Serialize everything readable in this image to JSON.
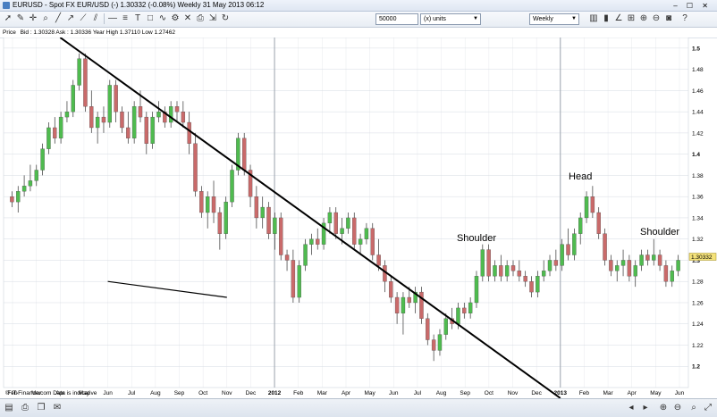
{
  "window": {
    "title": "EURUSD - Spot FX EUR/USD (-)   1.30332 (-0.08%)   Weekly  31 May 2013 06:12",
    "controls": "– ☐ ✕"
  },
  "toolbar": {
    "quantity_value": "50000",
    "units_value": "(x) units",
    "period_value": "Weekly"
  },
  "infobar": {
    "price_label": "Price",
    "quote_text": "Bid : 1.30328 Ask : 1.30336 Year High 1.37110 Low 1.27462"
  },
  "chart_data": {
    "type": "candlestick",
    "instrument": "EUR/USD",
    "timeframe": "Weekly",
    "y_range": [
      1.18,
      1.51
    ],
    "y_ticks": [
      "1.5",
      "1.48",
      "1.46",
      "1.44",
      "1.42",
      "1.4",
      "1.38",
      "1.36",
      "1.34",
      "1.32",
      "1.3",
      "1.28",
      "1.26",
      "1.24",
      "1.22",
      "1.2"
    ],
    "bold_ticks": [
      "1.5",
      "1.4",
      "1.3",
      "1.2"
    ],
    "x_labels": [
      "Feb",
      "Mar",
      "Apr",
      "May",
      "Jun",
      "Jul",
      "Aug",
      "Sep",
      "Oct",
      "Nov",
      "Dec",
      "2012",
      "Feb",
      "Mar",
      "Apr",
      "May",
      "Jun",
      "Jul",
      "Aug",
      "Sep",
      "Oct",
      "Nov",
      "Dec",
      "2013",
      "Feb",
      "Mar",
      "Apr",
      "May",
      "Jun"
    ],
    "year_separators": [
      "2012",
      "2013"
    ],
    "candles": [
      [
        1.36,
        1.365,
        1.35,
        1.355
      ],
      [
        1.355,
        1.37,
        1.345,
        1.365
      ],
      [
        1.365,
        1.38,
        1.36,
        1.37
      ],
      [
        1.37,
        1.39,
        1.365,
        1.375
      ],
      [
        1.375,
        1.39,
        1.37,
        1.385
      ],
      [
        1.385,
        1.41,
        1.38,
        1.405
      ],
      [
        1.405,
        1.43,
        1.4,
        1.425
      ],
      [
        1.425,
        1.435,
        1.41,
        1.415
      ],
      [
        1.415,
        1.44,
        1.41,
        1.435
      ],
      [
        1.435,
        1.45,
        1.43,
        1.44
      ],
      [
        1.44,
        1.47,
        1.435,
        1.465
      ],
      [
        1.465,
        1.495,
        1.46,
        1.49
      ],
      [
        1.49,
        1.495,
        1.44,
        1.445
      ],
      [
        1.445,
        1.46,
        1.42,
        1.425
      ],
      [
        1.425,
        1.44,
        1.41,
        1.435
      ],
      [
        1.435,
        1.445,
        1.42,
        1.43
      ],
      [
        1.43,
        1.47,
        1.425,
        1.465
      ],
      [
        1.465,
        1.47,
        1.43,
        1.44
      ],
      [
        1.44,
        1.445,
        1.42,
        1.425
      ],
      [
        1.425,
        1.44,
        1.41,
        1.415
      ],
      [
        1.415,
        1.45,
        1.41,
        1.445
      ],
      [
        1.445,
        1.46,
        1.43,
        1.435
      ],
      [
        1.435,
        1.44,
        1.4,
        1.41
      ],
      [
        1.41,
        1.44,
        1.405,
        1.435
      ],
      [
        1.435,
        1.45,
        1.43,
        1.44
      ],
      [
        1.44,
        1.445,
        1.425,
        1.43
      ],
      [
        1.43,
        1.45,
        1.425,
        1.445
      ],
      [
        1.445,
        1.45,
        1.43,
        1.44
      ],
      [
        1.44,
        1.45,
        1.425,
        1.43
      ],
      [
        1.43,
        1.44,
        1.4,
        1.41
      ],
      [
        1.41,
        1.42,
        1.36,
        1.365
      ],
      [
        1.365,
        1.37,
        1.34,
        1.345
      ],
      [
        1.345,
        1.365,
        1.33,
        1.36
      ],
      [
        1.36,
        1.375,
        1.335,
        1.345
      ],
      [
        1.345,
        1.35,
        1.31,
        1.325
      ],
      [
        1.325,
        1.36,
        1.32,
        1.355
      ],
      [
        1.355,
        1.39,
        1.35,
        1.385
      ],
      [
        1.385,
        1.42,
        1.38,
        1.415
      ],
      [
        1.415,
        1.42,
        1.38,
        1.385
      ],
      [
        1.385,
        1.39,
        1.35,
        1.36
      ],
      [
        1.36,
        1.37,
        1.33,
        1.34
      ],
      [
        1.34,
        1.36,
        1.33,
        1.35
      ],
      [
        1.35,
        1.355,
        1.32,
        1.325
      ],
      [
        1.325,
        1.345,
        1.31,
        1.34
      ],
      [
        1.34,
        1.345,
        1.3,
        1.305
      ],
      [
        1.305,
        1.31,
        1.29,
        1.3
      ],
      [
        1.3,
        1.31,
        1.26,
        1.265
      ],
      [
        1.265,
        1.3,
        1.26,
        1.295
      ],
      [
        1.295,
        1.32,
        1.29,
        1.315
      ],
      [
        1.315,
        1.325,
        1.305,
        1.32
      ],
      [
        1.32,
        1.33,
        1.31,
        1.315
      ],
      [
        1.315,
        1.34,
        1.31,
        1.335
      ],
      [
        1.335,
        1.35,
        1.325,
        1.345
      ],
      [
        1.345,
        1.35,
        1.32,
        1.325
      ],
      [
        1.325,
        1.34,
        1.315,
        1.33
      ],
      [
        1.33,
        1.345,
        1.325,
        1.34
      ],
      [
        1.34,
        1.345,
        1.31,
        1.315
      ],
      [
        1.315,
        1.325,
        1.305,
        1.32
      ],
      [
        1.32,
        1.335,
        1.315,
        1.33
      ],
      [
        1.33,
        1.335,
        1.3,
        1.305
      ],
      [
        1.305,
        1.32,
        1.29,
        1.295
      ],
      [
        1.295,
        1.3,
        1.27,
        1.28
      ],
      [
        1.28,
        1.285,
        1.26,
        1.265
      ],
      [
        1.265,
        1.27,
        1.24,
        1.25
      ],
      [
        1.25,
        1.27,
        1.23,
        1.265
      ],
      [
        1.265,
        1.275,
        1.255,
        1.26
      ],
      [
        1.26,
        1.275,
        1.25,
        1.27
      ],
      [
        1.27,
        1.275,
        1.24,
        1.245
      ],
      [
        1.245,
        1.25,
        1.22,
        1.225
      ],
      [
        1.225,
        1.23,
        1.205,
        1.215
      ],
      [
        1.215,
        1.235,
        1.21,
        1.23
      ],
      [
        1.23,
        1.25,
        1.225,
        1.245
      ],
      [
        1.245,
        1.255,
        1.235,
        1.24
      ],
      [
        1.24,
        1.26,
        1.235,
        1.255
      ],
      [
        1.255,
        1.26,
        1.245,
        1.25
      ],
      [
        1.25,
        1.265,
        1.245,
        1.26
      ],
      [
        1.26,
        1.29,
        1.255,
        1.285
      ],
      [
        1.285,
        1.315,
        1.28,
        1.31
      ],
      [
        1.31,
        1.315,
        1.28,
        1.285
      ],
      [
        1.285,
        1.3,
        1.28,
        1.295
      ],
      [
        1.295,
        1.305,
        1.28,
        1.285
      ],
      [
        1.285,
        1.3,
        1.28,
        1.295
      ],
      [
        1.295,
        1.3,
        1.285,
        1.29
      ],
      [
        1.29,
        1.3,
        1.28,
        1.285
      ],
      [
        1.285,
        1.29,
        1.275,
        1.28
      ],
      [
        1.28,
        1.285,
        1.265,
        1.27
      ],
      [
        1.27,
        1.29,
        1.265,
        1.285
      ],
      [
        1.285,
        1.3,
        1.28,
        1.29
      ],
      [
        1.29,
        1.305,
        1.285,
        1.3
      ],
      [
        1.3,
        1.31,
        1.29,
        1.295
      ],
      [
        1.295,
        1.32,
        1.29,
        1.315
      ],
      [
        1.315,
        1.33,
        1.3,
        1.305
      ],
      [
        1.305,
        1.33,
        1.3,
        1.325
      ],
      [
        1.325,
        1.345,
        1.315,
        1.34
      ],
      [
        1.34,
        1.365,
        1.335,
        1.36
      ],
      [
        1.36,
        1.37,
        1.34,
        1.345
      ],
      [
        1.345,
        1.35,
        1.32,
        1.325
      ],
      [
        1.325,
        1.33,
        1.295,
        1.3
      ],
      [
        1.3,
        1.305,
        1.285,
        1.29
      ],
      [
        1.29,
        1.3,
        1.28,
        1.295
      ],
      [
        1.295,
        1.31,
        1.285,
        1.3
      ],
      [
        1.3,
        1.305,
        1.28,
        1.285
      ],
      [
        1.285,
        1.3,
        1.275,
        1.295
      ],
      [
        1.295,
        1.31,
        1.29,
        1.305
      ],
      [
        1.305,
        1.31,
        1.295,
        1.3
      ],
      [
        1.3,
        1.32,
        1.295,
        1.305
      ],
      [
        1.305,
        1.31,
        1.29,
        1.295
      ],
      [
        1.295,
        1.3,
        1.275,
        1.28
      ],
      [
        1.28,
        1.295,
        1.275,
        1.29
      ],
      [
        1.29,
        1.305,
        1.285,
        1.3
      ]
    ],
    "last_price": "1.30332",
    "annotations": [
      "Shoulder",
      "Head",
      "Shoulder"
    ],
    "trendlines": [
      {
        "name": "downtrend",
        "from": [
          "Apr",
          1.51
        ],
        "to": [
          "2013",
          1.17
        ]
      },
      {
        "name": "neckline",
        "from": [
          "Nov",
          1.265
        ],
        "to": [
          "Jun",
          1.28
        ]
      }
    ],
    "colors": {
      "up": "#4fbb4f",
      "down": "#c96a6a",
      "line": "#000000",
      "grid": "#d6dbe3",
      "separator": "#9aa3ad"
    }
  },
  "footer": {
    "source_text": "© IT-Finance.com  Data is indicative"
  }
}
